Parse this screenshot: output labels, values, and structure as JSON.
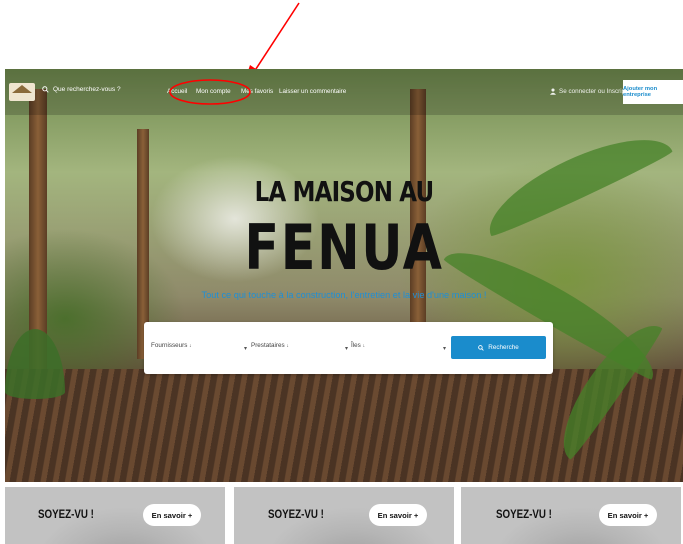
{
  "nav": {
    "search_placeholder": "Que recherchez-vous ?",
    "links": [
      "Accueil",
      "Mon compte",
      "Mes favoris",
      "Laisser un commentaire"
    ],
    "login": "Se connecter ou Inscription",
    "add_business": "Ajouter mon entreprise"
  },
  "hero": {
    "title_line1": "LA MAISON AU",
    "title_line2": "FENUA",
    "subtitle": "Tout ce qui touche à la construction, l'entretien et la vie d'une maison !"
  },
  "search": {
    "fields": [
      "Fournisseurs",
      "Prestataires",
      "Îles"
    ],
    "button": "Recherche"
  },
  "cards": [
    {
      "title": "SOYEZ-VU !",
      "button": "En savoir +"
    },
    {
      "title": "SOYEZ-VU !",
      "button": "En savoir +"
    },
    {
      "title": "SOYEZ-VU !",
      "button": "En savoir +"
    }
  ],
  "colors": {
    "accent": "#1a8ccc",
    "annotation": "#ff0000"
  }
}
